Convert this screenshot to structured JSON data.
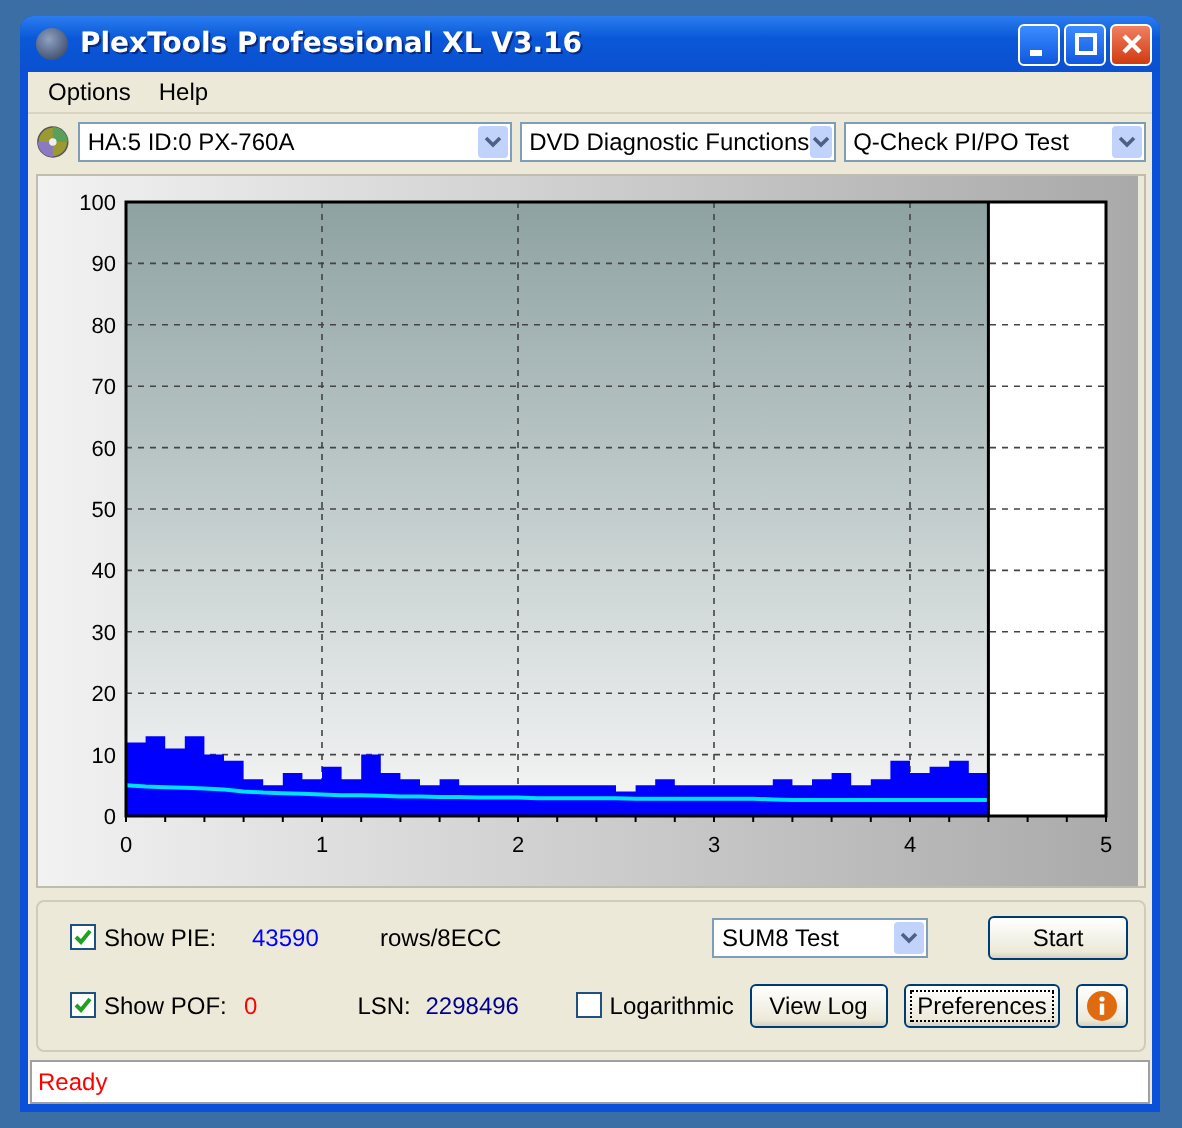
{
  "window": {
    "title": "PlexTools Professional XL V3.16"
  },
  "menu": [
    "Options",
    "Help"
  ],
  "toolbar": {
    "drive": "HA:5 ID:0  PX-760A",
    "function": "DVD Diagnostic Functions",
    "test": "Q-Check PI/PO Test"
  },
  "chart_data": {
    "type": "area",
    "grid": true,
    "ref_lines": [
      {
        "axis": "x",
        "value": 4.4,
        "color": "#000000"
      }
    ],
    "bands": [
      {
        "axis": "x",
        "from": 4.4,
        "to": 5,
        "color": "#ffffff"
      }
    ],
    "xlim": [
      0,
      5
    ],
    "ylim": [
      0,
      100
    ],
    "xticks": [
      0,
      1,
      2,
      3,
      4,
      5
    ],
    "yticks": [
      0,
      10,
      20,
      30,
      40,
      50,
      60,
      70,
      80,
      90,
      100
    ],
    "x": [
      0,
      0.1,
      0.2,
      0.3,
      0.4,
      0.5,
      0.6,
      0.7,
      0.8,
      0.9,
      1,
      1.1,
      1.2,
      1.3,
      1.4,
      1.5,
      1.6,
      1.7,
      1.8,
      1.9,
      2,
      2.1,
      2.2,
      2.3,
      2.4,
      2.5,
      2.6,
      2.7,
      2.8,
      2.9,
      3,
      3.1,
      3.2,
      3.3,
      3.4,
      3.5,
      3.6,
      3.7,
      3.8,
      3.9,
      4,
      4.1,
      4.2,
      4.3,
      4.4
    ],
    "series": [
      {
        "color": "#0000ff",
        "values": [
          12,
          13,
          11,
          13,
          10,
          9,
          6,
          5,
          7,
          6,
          8,
          6,
          10,
          7,
          6,
          5,
          6,
          5,
          5,
          5,
          5,
          5,
          5,
          5,
          5,
          4,
          5,
          6,
          5,
          5,
          5,
          5,
          5,
          6,
          5,
          6,
          7,
          5,
          6,
          9,
          7,
          8,
          9,
          7,
          9
        ]
      },
      {
        "type": "line",
        "color": "#00e0ff",
        "values": [
          5,
          4.8,
          4.7,
          4.6,
          4.5,
          4.3,
          4,
          3.8,
          3.7,
          3.6,
          3.5,
          3.4,
          3.4,
          3.3,
          3.2,
          3.2,
          3.1,
          3.1,
          3,
          3,
          3,
          2.9,
          2.9,
          2.9,
          2.9,
          2.9,
          2.8,
          2.8,
          2.8,
          2.8,
          2.8,
          2.8,
          2.8,
          2.7,
          2.6,
          2.6,
          2.6,
          2.6,
          2.6,
          2.6,
          2.6,
          2.6,
          2.6,
          2.6,
          2.6
        ]
      }
    ]
  },
  "controls": {
    "show_pie": {
      "label": "Show PIE:",
      "checked": true,
      "value": "43590",
      "unit": "rows/8ECC"
    },
    "show_pof": {
      "label": "Show POF:",
      "checked": true,
      "value": "0"
    },
    "lsn": {
      "label": "LSN:",
      "value": "2298496"
    },
    "logarithmic": {
      "label": "Logarithmic",
      "checked": false
    },
    "test_mode": "SUM8 Test",
    "buttons": [
      "Start",
      "View Log",
      "Preferences"
    ]
  },
  "status_bar": "Ready"
}
